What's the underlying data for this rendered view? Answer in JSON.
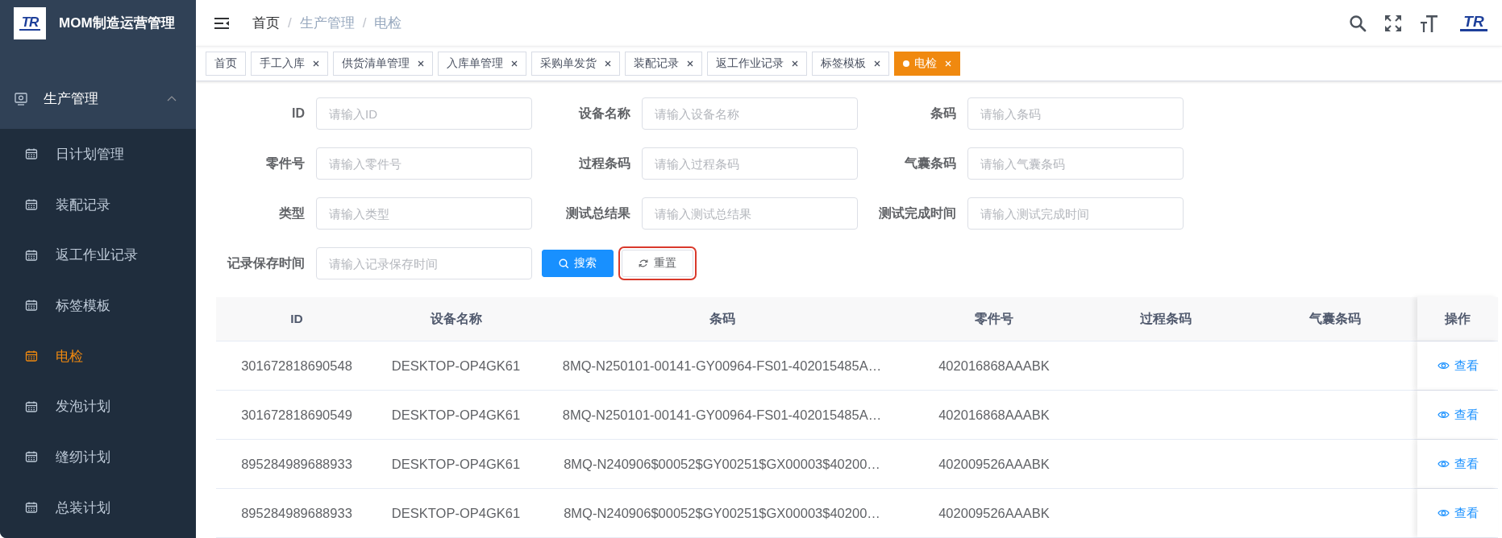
{
  "sidebar": {
    "logo_text": "TR",
    "title": "MOM制造运营管理",
    "group": {
      "label": "生产管理",
      "expanded": true
    },
    "items": [
      {
        "label": "日计划管理",
        "selected": false
      },
      {
        "label": "装配记录",
        "selected": false
      },
      {
        "label": "返工作业记录",
        "selected": false
      },
      {
        "label": "标签模板",
        "selected": false
      },
      {
        "label": "电检",
        "selected": true
      },
      {
        "label": "发泡计划",
        "selected": false
      },
      {
        "label": "缝纫计划",
        "selected": false
      },
      {
        "label": "总装计划",
        "selected": false
      }
    ]
  },
  "navbar": {
    "breadcrumb": [
      "首页",
      "生产管理",
      "电检"
    ],
    "separator": "/",
    "logo_text": "TR"
  },
  "tags": [
    {
      "label": "首页",
      "closable": false,
      "selected": false
    },
    {
      "label": "手工入库",
      "closable": true,
      "selected": false
    },
    {
      "label": "供货清单管理",
      "closable": true,
      "selected": false
    },
    {
      "label": "入库单管理",
      "closable": true,
      "selected": false
    },
    {
      "label": "采购单发货",
      "closable": true,
      "selected": false
    },
    {
      "label": "装配记录",
      "closable": true,
      "selected": false
    },
    {
      "label": "返工作业记录",
      "closable": true,
      "selected": false
    },
    {
      "label": "标签模板",
      "closable": true,
      "selected": false
    },
    {
      "label": "电检",
      "closable": true,
      "selected": true
    }
  ],
  "search_form": {
    "fields": [
      {
        "label": "ID",
        "placeholder": "请输入ID"
      },
      {
        "label": "设备名称",
        "placeholder": "请输入设备名称"
      },
      {
        "label": "条码",
        "placeholder": "请输入条码"
      },
      {
        "label": "零件号",
        "placeholder": "请输入零件号"
      },
      {
        "label": "过程条码",
        "placeholder": "请输入过程条码"
      },
      {
        "label": "气囊条码",
        "placeholder": "请输入气囊条码"
      },
      {
        "label": "类型",
        "placeholder": "请输入类型"
      },
      {
        "label": "测试总结果",
        "placeholder": "请输入测试总结果"
      },
      {
        "label": "测试完成时间",
        "placeholder": "请输入测试完成时间"
      },
      {
        "label": "记录保存时间",
        "placeholder": "请输入记录保存时间"
      }
    ],
    "buttons": [
      {
        "label": "搜索",
        "kind": "primary",
        "highlighted": false
      },
      {
        "label": "重置",
        "kind": "default",
        "highlighted": true
      }
    ]
  },
  "table": {
    "columns": [
      "ID",
      "设备名称",
      "条码",
      "零件号",
      "过程条码",
      "气囊条码",
      "操作"
    ],
    "rows": [
      {
        "cells": [
          "301672818690548",
          "DESKTOP-OP4GK61",
          "8MQ-N250101-00141-GY00964-FS01-402015485A…",
          "402016868AAABK",
          "",
          ""
        ],
        "action": "查看"
      },
      {
        "cells": [
          "301672818690549",
          "DESKTOP-OP4GK61",
          "8MQ-N250101-00141-GY00964-FS01-402015485A…",
          "402016868AAABK",
          "",
          ""
        ],
        "action": "查看"
      },
      {
        "cells": [
          "895284989688933",
          "DESKTOP-OP4GK61",
          "8MQ-N240906$00052$GY00251$GX00003$40200…",
          "402009526AAABK",
          "",
          ""
        ],
        "action": "查看"
      },
      {
        "cells": [
          "895284989688933",
          "DESKTOP-OP4GK61",
          "8MQ-N240906$00052$GY00251$GX00003$40200…",
          "402009526AAABK",
          "",
          ""
        ],
        "action": "查看"
      }
    ]
  }
}
